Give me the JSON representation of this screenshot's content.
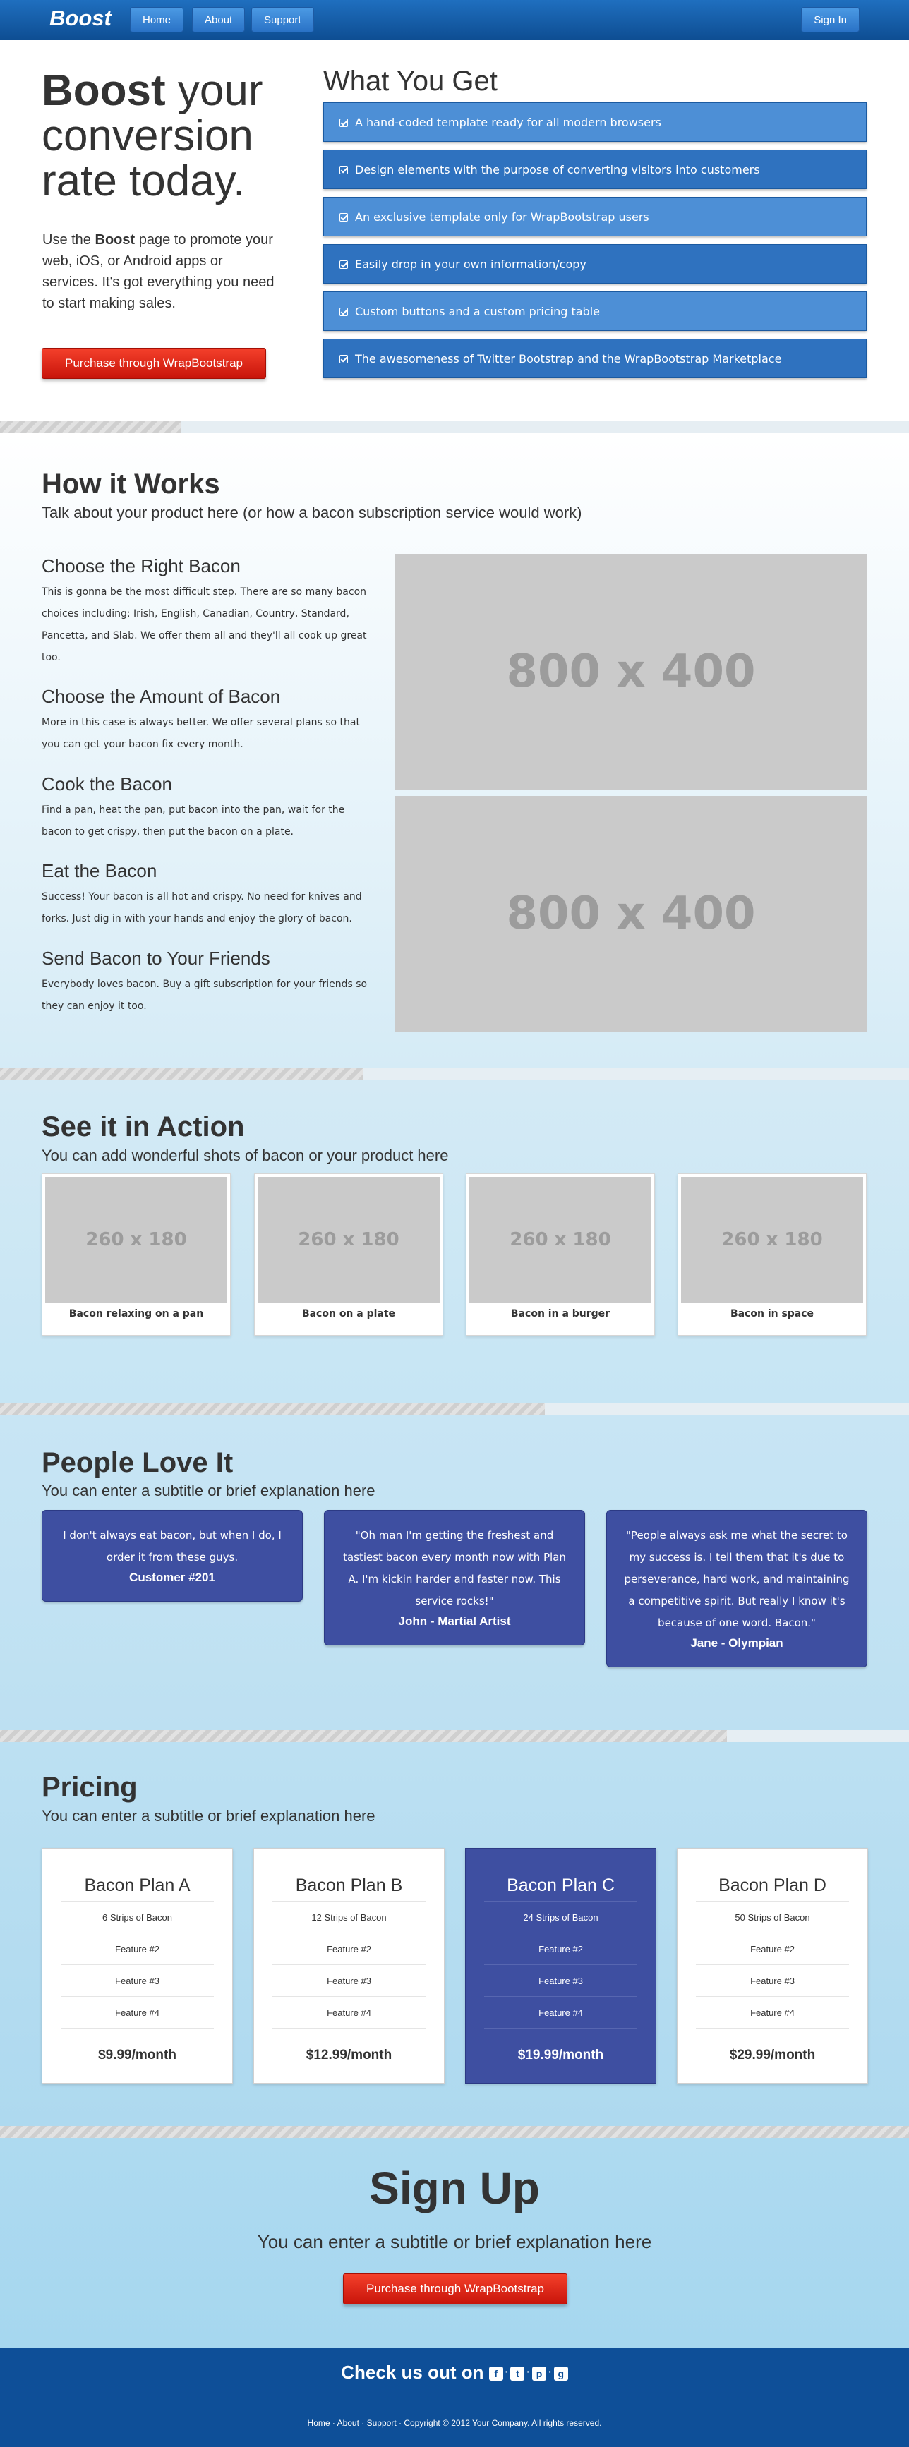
{
  "nav": {
    "brand": "Boost",
    "home": "Home",
    "about": "About",
    "support": "Support",
    "signin": "Sign In"
  },
  "hero": {
    "title_bold": "Boost",
    "title_rest": "your conversion rate today.",
    "lead_pre": "Use the",
    "lead_bold": "Boost",
    "lead_post": "page to promote your web, iOS, or Android apps or services. It's got everything you need to start making sales.",
    "cta": "Purchase through WrapBootstrap",
    "features_title": "What You Get",
    "features": [
      "A hand-coded template ready for all modern browsers",
      "Design elements with the purpose of converting visitors into customers",
      "An exclusive template only for WrapBootstrap users",
      "Easily drop in your own information/copy",
      "Custom buttons and a custom pricing table",
      "The awesomeness of Twitter Bootstrap and the WrapBootstrap Marketplace"
    ]
  },
  "how": {
    "title": "How it Works",
    "subtitle": "Talk about your product here (or how a bacon subscription service would work)",
    "steps": [
      {
        "title": "Choose the Right Bacon",
        "text": "This is gonna be the most difficult step. There are so many bacon choices including: Irish, English, Canadian, Country, Standard, Pancetta, and Slab. We offer them all and they'll all cook up great too."
      },
      {
        "title": "Choose the Amount of Bacon",
        "text": "More in this case is always better. We offer several plans so that you can get your bacon fix every month."
      },
      {
        "title": "Cook the Bacon",
        "text": "Find a pan, heat the pan, put bacon into the pan, wait for the bacon to get crispy, then put the bacon on a plate."
      },
      {
        "title": "Eat the Bacon",
        "text": "Success! Your bacon is all hot and crispy. No need for knives and forks. Just dig in with your hands and enjoy the glory of bacon."
      },
      {
        "title": "Send Bacon to Your Friends",
        "text": "Everybody loves bacon. Buy a gift subscription for your friends so they can enjoy it too."
      }
    ],
    "image1": "800 x 400",
    "image2": "800 x 400"
  },
  "action": {
    "title": "See it in Action",
    "subtitle": "You can add wonderful shots of bacon or your product here",
    "cards": [
      {
        "image": "260 x 180",
        "caption": "Bacon relaxing on a pan"
      },
      {
        "image": "260 x 180",
        "caption": "Bacon on a plate"
      },
      {
        "image": "260 x 180",
        "caption": "Bacon in a burger"
      },
      {
        "image": "260 x 180",
        "caption": "Bacon in space"
      }
    ]
  },
  "love": {
    "title": "People Love It",
    "subtitle": "You can enter a subtitle or brief explanation here",
    "quotes": [
      {
        "text": "I don't always eat bacon, but when I do, I order it from these guys.",
        "author": "Customer #201"
      },
      {
        "text": "\"Oh man I'm getting the freshest and tastiest bacon every month now with Plan A. I'm kickin harder and faster now. This service rocks!\"",
        "author": "John - Martial Artist"
      },
      {
        "text": "\"People always ask me what the secret to my success is. I tell them that it's due to perseverance, hard work, and maintaining a competitive spirit. But really I know it's because of one word. Bacon.\"",
        "author": "Jane - Olympian"
      }
    ]
  },
  "pricing": {
    "title": "Pricing",
    "subtitle": "You can enter a subtitle or brief explanation here",
    "plans": [
      {
        "name": "Bacon Plan A",
        "strips": "6 Strips of Bacon",
        "f2": "Feature #2",
        "f3": "Feature #3",
        "f4": "Feature #4",
        "price": "$9.99/month"
      },
      {
        "name": "Bacon Plan B",
        "strips": "12 Strips of Bacon",
        "f2": "Feature #2",
        "f3": "Feature #3",
        "f4": "Feature #4",
        "price": "$12.99/month"
      },
      {
        "name": "Bacon Plan C",
        "strips": "24 Strips of Bacon",
        "f2": "Feature #2",
        "f3": "Feature #3",
        "f4": "Feature #4",
        "price": "$19.99/month"
      },
      {
        "name": "Bacon Plan D",
        "strips": "50 Strips of Bacon",
        "f2": "Feature #2",
        "f3": "Feature #3",
        "f4": "Feature #4",
        "price": "$29.99/month"
      }
    ],
    "highlight_color": "#3e4fa1"
  },
  "signup": {
    "title": "Sign Up",
    "subtitle": "You can enter a subtitle or brief explanation here",
    "cta": "Purchase through WrapBootstrap"
  },
  "footer": {
    "check": "Check us out on",
    "social": {
      "facebook": "f",
      "twitter": "t",
      "pinterest": "p",
      "google": "g"
    },
    "links": {
      "home": "Home",
      "about": "About",
      "support": "Support"
    },
    "sep": "·",
    "copyright": "Copyright © 2012 Your Company. All rights reserved."
  },
  "colors": {
    "accent": "#0e4f98",
    "cta": "#d6200f",
    "feature": "#4d8fd6"
  }
}
